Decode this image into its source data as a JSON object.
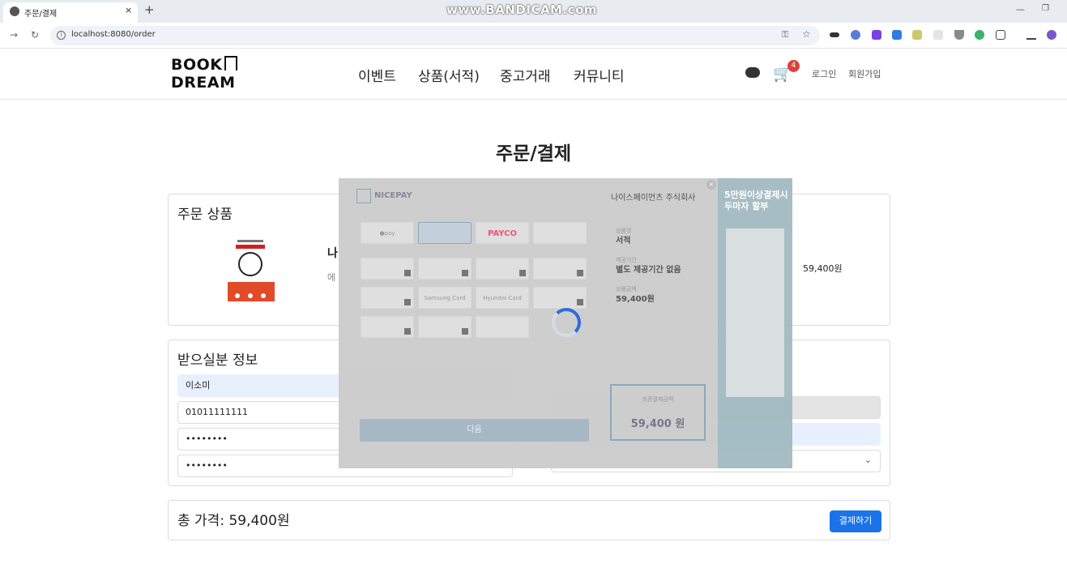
{
  "browser": {
    "tab_title": "주문/결제",
    "tab_close": "×",
    "new_tab": "+",
    "url": "localhost:8080/order",
    "watermark": "www.BANDICAM.com"
  },
  "site": {
    "logo_line1": "BOOK",
    "logo_line2": "DREAM",
    "nav": [
      "이벤트",
      "상품(서적)",
      "중고거래",
      "커뮤니티"
    ],
    "cart_count": "4",
    "login": "로그인",
    "signup": "회원가입"
  },
  "page": {
    "title": "주문/결제",
    "order_items": {
      "heading": "주문 상품",
      "book_name_partial": "나",
      "book_sub_partial": "에",
      "price": "59,400원"
    },
    "recipient": {
      "heading": "받으실분 정보",
      "name": "이소미",
      "phone": "01011111111",
      "password1": "••••••••",
      "password2": "••••••••"
    },
    "total": {
      "label": "총 가격: 59,400원",
      "pay_button": "결제하기"
    }
  },
  "popup": {
    "brand": "NICEPAY",
    "company": "나이스페이먼츠 주식회사",
    "methods": {
      "payco": "PAYCO",
      "pay": "●pay",
      "samsung": "Samsung Card",
      "hyundai": "Hyundai Card"
    },
    "product_label": "상품명",
    "product_value": "서적",
    "period_label": "제공기간",
    "period_value": "별도 제공기간 없음",
    "amount_label": "상품금액",
    "amount_value": "59,400원",
    "final_label": "최종결제금액",
    "final_value": "59,400 원",
    "next_button": "다음",
    "ad_title_1": "5만원이상결제시",
    "ad_title_2": "두마자 할부"
  },
  "colors": {
    "accent": "#1a73e8",
    "badge": "#e0413a",
    "spinner": "#2f6bd9"
  }
}
